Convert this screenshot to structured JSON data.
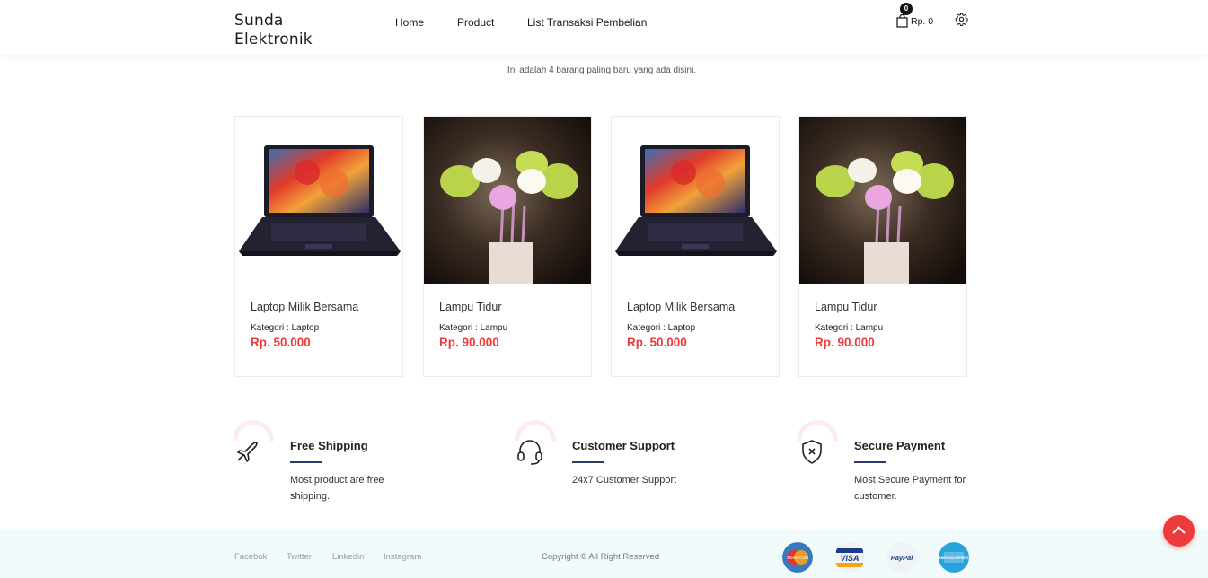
{
  "header": {
    "brand_line1": "Sunda",
    "brand_line2": "Elektronik",
    "nav": {
      "home": "Home",
      "product": "Product",
      "list": "List Transaksi Pembelian"
    },
    "cart_count": "0",
    "cart_total": "Rp. 0"
  },
  "intro": "Ini adalah 4 barang paling baru yang ada disini.",
  "products": [
    {
      "name": "Laptop Milik Bersama",
      "category": "Kategori : Laptop",
      "price": "Rp. 50.000",
      "image": "laptop-image"
    },
    {
      "name": "Lampu Tidur",
      "category": "Kategori : Lampu",
      "price": "Rp. 90.000",
      "image": "lamp-image"
    },
    {
      "name": "Laptop Milik Bersama",
      "category": "Kategori : Laptop",
      "price": "Rp. 50.000",
      "image": "laptop-image"
    },
    {
      "name": "Lampu Tidur",
      "category": "Kategori : Lampu",
      "price": "Rp. 90.000",
      "image": "lamp-image"
    }
  ],
  "features": [
    {
      "title": "Free Shipping",
      "desc": "Most product are free shipping.",
      "icon": "airplane-icon"
    },
    {
      "title": "Customer Support",
      "desc": "24x7 Customer Support",
      "icon": "headset-icon"
    },
    {
      "title": "Secure Payment",
      "desc": "Most Secure Payment for customer.",
      "icon": "shield-icon"
    }
  ],
  "footer": {
    "social": [
      "Facebok",
      "Twitter",
      "Linkedin",
      "Instagram"
    ],
    "copyright": "Copyright © All Right Reserved",
    "payments": [
      {
        "name": "MasterCard",
        "icon": "mastercard-icon"
      },
      {
        "name": "VISA",
        "icon": "visa-icon"
      },
      {
        "name": "PayPal",
        "icon": "paypal-icon"
      },
      {
        "name": "AMERICAN EXPRESS",
        "icon": "amex-icon"
      }
    ]
  },
  "colors": {
    "accent": "#ee3a3a",
    "title_underline": "#2b3a67",
    "footer_bg": "#f1fbfb"
  }
}
